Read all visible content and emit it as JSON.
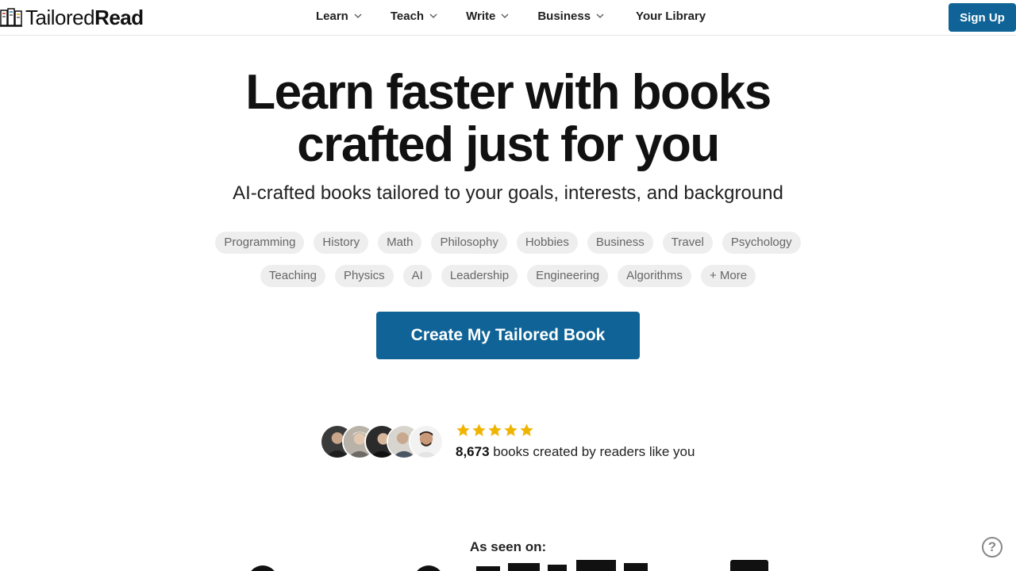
{
  "header": {
    "brand_regular": "Tailored",
    "brand_bold": "Read",
    "nav": [
      {
        "label": "Learn"
      },
      {
        "label": "Teach"
      },
      {
        "label": "Write"
      },
      {
        "label": "Business"
      }
    ],
    "library_label": "Your Library",
    "signup_label": "Sign Up"
  },
  "hero": {
    "title_line1": "Learn faster with books",
    "title_line2": "crafted just for you",
    "subtitle": "AI-crafted books tailored to your goals, interests, and background",
    "topics_row1": [
      "Programming",
      "History",
      "Math",
      "Philosophy",
      "Hobbies",
      "Business",
      "Travel",
      "Psychology"
    ],
    "topics_row2": [
      "Teaching",
      "Physics",
      "AI",
      "Leadership",
      "Engineering",
      "Algorithms",
      "+ More"
    ],
    "cta_label": "Create My Tailored Book"
  },
  "social_proof": {
    "rating_stars": 5,
    "count": "8,673",
    "text": " books created by readers like you"
  },
  "seen_on": {
    "label": "As seen on:"
  },
  "help": {
    "label": "?"
  },
  "colors": {
    "accent": "#0f6396",
    "star": "#f0b400",
    "chip_bg": "#eeeeee"
  }
}
